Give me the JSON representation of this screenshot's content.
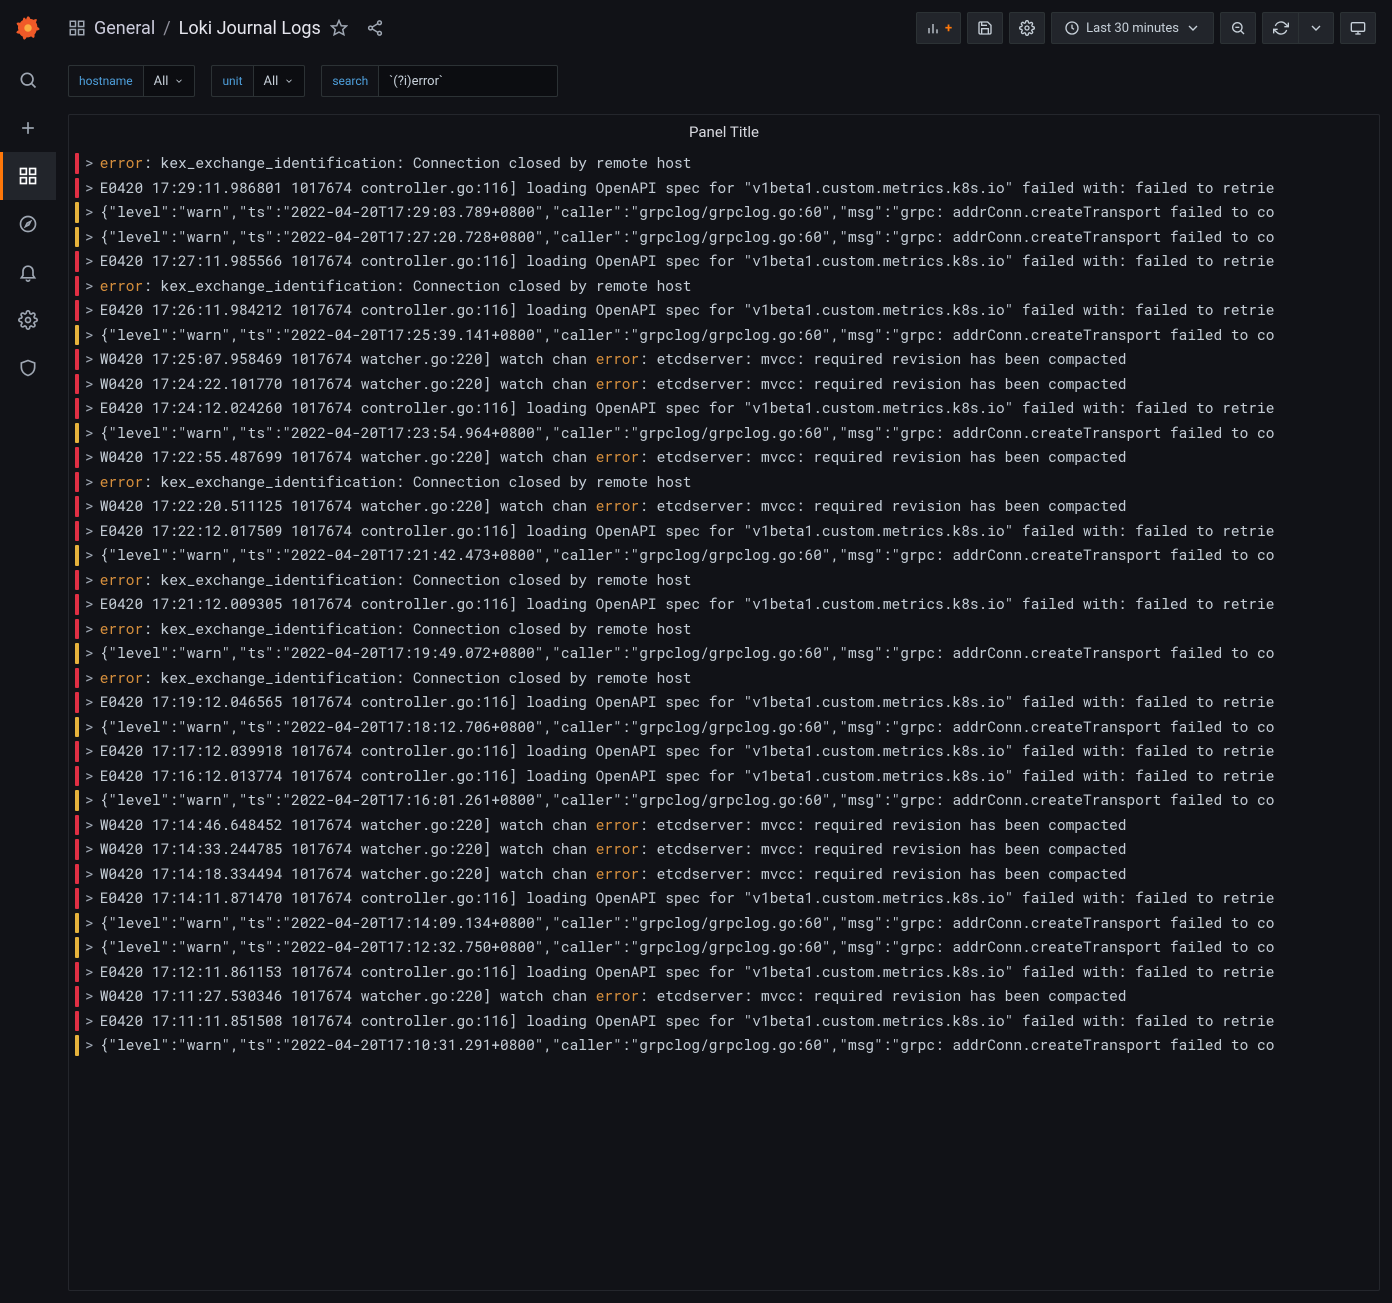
{
  "breadcrumb": {
    "folder": "General",
    "title": "Loki Journal Logs"
  },
  "toolbar": {
    "time_label": "Last 30 minutes"
  },
  "variables": {
    "hostname": {
      "label": "hostname",
      "value": "All"
    },
    "unit": {
      "label": "unit",
      "value": "All"
    },
    "search": {
      "label": "search",
      "value": "`(?i)error`"
    }
  },
  "panel": {
    "title": "Panel Title"
  },
  "words": {
    "error": "error"
  },
  "logs": [
    {
      "level": "red",
      "pre": "",
      "hl": "error",
      "post": ": kex_exchange_identification: Connection closed by remote host"
    },
    {
      "level": "red",
      "pre": "E0420 17:29:11.986801 1017674 controller.go:116] loading OpenAPI spec for \"v1beta1.custom.metrics.k8s.io\" failed with: failed to retrie",
      "hl": "",
      "post": ""
    },
    {
      "level": "yellow",
      "pre": "{\"level\":\"warn\",\"ts\":\"2022-04-20T17:29:03.789+0800\",\"caller\":\"grpclog/grpclog.go:60\",\"msg\":\"grpc: addrConn.createTransport failed to co",
      "hl": "",
      "post": ""
    },
    {
      "level": "yellow",
      "pre": "{\"level\":\"warn\",\"ts\":\"2022-04-20T17:27:20.728+0800\",\"caller\":\"grpclog/grpclog.go:60\",\"msg\":\"grpc: addrConn.createTransport failed to co",
      "hl": "",
      "post": ""
    },
    {
      "level": "red",
      "pre": "E0420 17:27:11.985566 1017674 controller.go:116] loading OpenAPI spec for \"v1beta1.custom.metrics.k8s.io\" failed with: failed to retrie",
      "hl": "",
      "post": ""
    },
    {
      "level": "red",
      "pre": "",
      "hl": "error",
      "post": ": kex_exchange_identification: Connection closed by remote host"
    },
    {
      "level": "red",
      "pre": "E0420 17:26:11.984212 1017674 controller.go:116] loading OpenAPI spec for \"v1beta1.custom.metrics.k8s.io\" failed with: failed to retrie",
      "hl": "",
      "post": ""
    },
    {
      "level": "yellow",
      "pre": "{\"level\":\"warn\",\"ts\":\"2022-04-20T17:25:39.141+0800\",\"caller\":\"grpclog/grpclog.go:60\",\"msg\":\"grpc: addrConn.createTransport failed to co",
      "hl": "",
      "post": ""
    },
    {
      "level": "red",
      "pre": "W0420 17:25:07.958469 1017674 watcher.go:220] watch chan ",
      "hl": "error",
      "post": ": etcdserver: mvcc: required revision has been compacted"
    },
    {
      "level": "red",
      "pre": "W0420 17:24:22.101770 1017674 watcher.go:220] watch chan ",
      "hl": "error",
      "post": ": etcdserver: mvcc: required revision has been compacted"
    },
    {
      "level": "red",
      "pre": "E0420 17:24:12.024260 1017674 controller.go:116] loading OpenAPI spec for \"v1beta1.custom.metrics.k8s.io\" failed with: failed to retrie",
      "hl": "",
      "post": ""
    },
    {
      "level": "yellow",
      "pre": "{\"level\":\"warn\",\"ts\":\"2022-04-20T17:23:54.964+0800\",\"caller\":\"grpclog/grpclog.go:60\",\"msg\":\"grpc: addrConn.createTransport failed to co",
      "hl": "",
      "post": ""
    },
    {
      "level": "red",
      "pre": "W0420 17:22:55.487699 1017674 watcher.go:220] watch chan ",
      "hl": "error",
      "post": ": etcdserver: mvcc: required revision has been compacted"
    },
    {
      "level": "red",
      "pre": "",
      "hl": "error",
      "post": ": kex_exchange_identification: Connection closed by remote host"
    },
    {
      "level": "red",
      "pre": "W0420 17:22:20.511125 1017674 watcher.go:220] watch chan ",
      "hl": "error",
      "post": ": etcdserver: mvcc: required revision has been compacted"
    },
    {
      "level": "red",
      "pre": "E0420 17:22:12.017509 1017674 controller.go:116] loading OpenAPI spec for \"v1beta1.custom.metrics.k8s.io\" failed with: failed to retrie",
      "hl": "",
      "post": ""
    },
    {
      "level": "yellow",
      "pre": "{\"level\":\"warn\",\"ts\":\"2022-04-20T17:21:42.473+0800\",\"caller\":\"grpclog/grpclog.go:60\",\"msg\":\"grpc: addrConn.createTransport failed to co",
      "hl": "",
      "post": ""
    },
    {
      "level": "red",
      "pre": "",
      "hl": "error",
      "post": ": kex_exchange_identification: Connection closed by remote host"
    },
    {
      "level": "red",
      "pre": "E0420 17:21:12.009305 1017674 controller.go:116] loading OpenAPI spec for \"v1beta1.custom.metrics.k8s.io\" failed with: failed to retrie",
      "hl": "",
      "post": ""
    },
    {
      "level": "red",
      "pre": "",
      "hl": "error",
      "post": ": kex_exchange_identification: Connection closed by remote host"
    },
    {
      "level": "yellow",
      "pre": "{\"level\":\"warn\",\"ts\":\"2022-04-20T17:19:49.072+0800\",\"caller\":\"grpclog/grpclog.go:60\",\"msg\":\"grpc: addrConn.createTransport failed to co",
      "hl": "",
      "post": ""
    },
    {
      "level": "red",
      "pre": "",
      "hl": "error",
      "post": ": kex_exchange_identification: Connection closed by remote host"
    },
    {
      "level": "red",
      "pre": "E0420 17:19:12.046565 1017674 controller.go:116] loading OpenAPI spec for \"v1beta1.custom.metrics.k8s.io\" failed with: failed to retrie",
      "hl": "",
      "post": ""
    },
    {
      "level": "yellow",
      "pre": "{\"level\":\"warn\",\"ts\":\"2022-04-20T17:18:12.706+0800\",\"caller\":\"grpclog/grpclog.go:60\",\"msg\":\"grpc: addrConn.createTransport failed to co",
      "hl": "",
      "post": ""
    },
    {
      "level": "red",
      "pre": "E0420 17:17:12.039918 1017674 controller.go:116] loading OpenAPI spec for \"v1beta1.custom.metrics.k8s.io\" failed with: failed to retrie",
      "hl": "",
      "post": ""
    },
    {
      "level": "red",
      "pre": "E0420 17:16:12.013774 1017674 controller.go:116] loading OpenAPI spec for \"v1beta1.custom.metrics.k8s.io\" failed with: failed to retrie",
      "hl": "",
      "post": ""
    },
    {
      "level": "yellow",
      "pre": "{\"level\":\"warn\",\"ts\":\"2022-04-20T17:16:01.261+0800\",\"caller\":\"grpclog/grpclog.go:60\",\"msg\":\"grpc: addrConn.createTransport failed to co",
      "hl": "",
      "post": ""
    },
    {
      "level": "red",
      "pre": "W0420 17:14:46.648452 1017674 watcher.go:220] watch chan ",
      "hl": "error",
      "post": ": etcdserver: mvcc: required revision has been compacted"
    },
    {
      "level": "red",
      "pre": "W0420 17:14:33.244785 1017674 watcher.go:220] watch chan ",
      "hl": "error",
      "post": ": etcdserver: mvcc: required revision has been compacted"
    },
    {
      "level": "red",
      "pre": "W0420 17:14:18.334494 1017674 watcher.go:220] watch chan ",
      "hl": "error",
      "post": ": etcdserver: mvcc: required revision has been compacted"
    },
    {
      "level": "red",
      "pre": "E0420 17:14:11.871470 1017674 controller.go:116] loading OpenAPI spec for \"v1beta1.custom.metrics.k8s.io\" failed with: failed to retrie",
      "hl": "",
      "post": ""
    },
    {
      "level": "yellow",
      "pre": "{\"level\":\"warn\",\"ts\":\"2022-04-20T17:14:09.134+0800\",\"caller\":\"grpclog/grpclog.go:60\",\"msg\":\"grpc: addrConn.createTransport failed to co",
      "hl": "",
      "post": ""
    },
    {
      "level": "yellow",
      "pre": "{\"level\":\"warn\",\"ts\":\"2022-04-20T17:12:32.750+0800\",\"caller\":\"grpclog/grpclog.go:60\",\"msg\":\"grpc: addrConn.createTransport failed to co",
      "hl": "",
      "post": ""
    },
    {
      "level": "red",
      "pre": "E0420 17:12:11.861153 1017674 controller.go:116] loading OpenAPI spec for \"v1beta1.custom.metrics.k8s.io\" failed with: failed to retrie",
      "hl": "",
      "post": ""
    },
    {
      "level": "red",
      "pre": "W0420 17:11:27.530346 1017674 watcher.go:220] watch chan ",
      "hl": "error",
      "post": ": etcdserver: mvcc: required revision has been compacted"
    },
    {
      "level": "red",
      "pre": "E0420 17:11:11.851508 1017674 controller.go:116] loading OpenAPI spec for \"v1beta1.custom.metrics.k8s.io\" failed with: failed to retrie",
      "hl": "",
      "post": ""
    },
    {
      "level": "yellow",
      "pre": "{\"level\":\"warn\",\"ts\":\"2022-04-20T17:10:31.291+0800\",\"caller\":\"grpclog/grpclog.go:60\",\"msg\":\"grpc: addrConn.createTransport failed to co",
      "hl": "",
      "post": ""
    }
  ]
}
